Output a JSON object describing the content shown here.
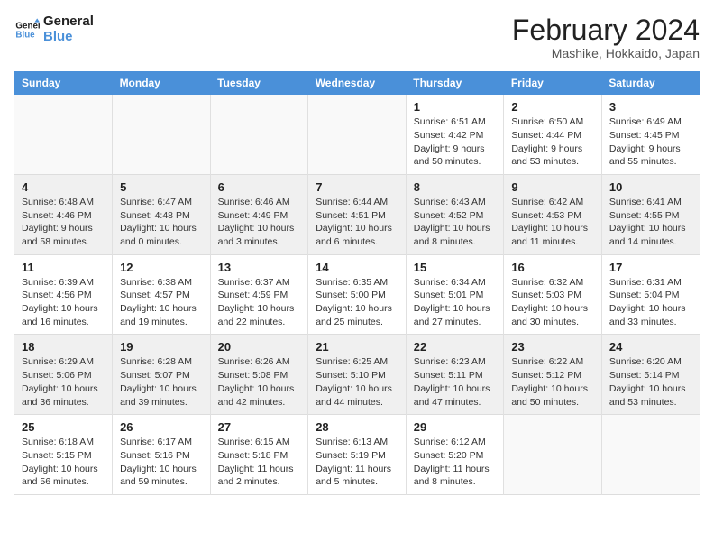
{
  "header": {
    "logo_general": "General",
    "logo_blue": "Blue",
    "title": "February 2024",
    "subtitle": "Mashike, Hokkaido, Japan"
  },
  "columns": [
    "Sunday",
    "Monday",
    "Tuesday",
    "Wednesday",
    "Thursday",
    "Friday",
    "Saturday"
  ],
  "weeks": [
    {
      "days": [
        {
          "number": "",
          "detail": ""
        },
        {
          "number": "",
          "detail": ""
        },
        {
          "number": "",
          "detail": ""
        },
        {
          "number": "",
          "detail": ""
        },
        {
          "number": "1",
          "detail": "Sunrise: 6:51 AM\nSunset: 4:42 PM\nDaylight: 9 hours\nand 50 minutes."
        },
        {
          "number": "2",
          "detail": "Sunrise: 6:50 AM\nSunset: 4:44 PM\nDaylight: 9 hours\nand 53 minutes."
        },
        {
          "number": "3",
          "detail": "Sunrise: 6:49 AM\nSunset: 4:45 PM\nDaylight: 9 hours\nand 55 minutes."
        }
      ]
    },
    {
      "days": [
        {
          "number": "4",
          "detail": "Sunrise: 6:48 AM\nSunset: 4:46 PM\nDaylight: 9 hours\nand 58 minutes."
        },
        {
          "number": "5",
          "detail": "Sunrise: 6:47 AM\nSunset: 4:48 PM\nDaylight: 10 hours\nand 0 minutes."
        },
        {
          "number": "6",
          "detail": "Sunrise: 6:46 AM\nSunset: 4:49 PM\nDaylight: 10 hours\nand 3 minutes."
        },
        {
          "number": "7",
          "detail": "Sunrise: 6:44 AM\nSunset: 4:51 PM\nDaylight: 10 hours\nand 6 minutes."
        },
        {
          "number": "8",
          "detail": "Sunrise: 6:43 AM\nSunset: 4:52 PM\nDaylight: 10 hours\nand 8 minutes."
        },
        {
          "number": "9",
          "detail": "Sunrise: 6:42 AM\nSunset: 4:53 PM\nDaylight: 10 hours\nand 11 minutes."
        },
        {
          "number": "10",
          "detail": "Sunrise: 6:41 AM\nSunset: 4:55 PM\nDaylight: 10 hours\nand 14 minutes."
        }
      ]
    },
    {
      "days": [
        {
          "number": "11",
          "detail": "Sunrise: 6:39 AM\nSunset: 4:56 PM\nDaylight: 10 hours\nand 16 minutes."
        },
        {
          "number": "12",
          "detail": "Sunrise: 6:38 AM\nSunset: 4:57 PM\nDaylight: 10 hours\nand 19 minutes."
        },
        {
          "number": "13",
          "detail": "Sunrise: 6:37 AM\nSunset: 4:59 PM\nDaylight: 10 hours\nand 22 minutes."
        },
        {
          "number": "14",
          "detail": "Sunrise: 6:35 AM\nSunset: 5:00 PM\nDaylight: 10 hours\nand 25 minutes."
        },
        {
          "number": "15",
          "detail": "Sunrise: 6:34 AM\nSunset: 5:01 PM\nDaylight: 10 hours\nand 27 minutes."
        },
        {
          "number": "16",
          "detail": "Sunrise: 6:32 AM\nSunset: 5:03 PM\nDaylight: 10 hours\nand 30 minutes."
        },
        {
          "number": "17",
          "detail": "Sunrise: 6:31 AM\nSunset: 5:04 PM\nDaylight: 10 hours\nand 33 minutes."
        }
      ]
    },
    {
      "days": [
        {
          "number": "18",
          "detail": "Sunrise: 6:29 AM\nSunset: 5:06 PM\nDaylight: 10 hours\nand 36 minutes."
        },
        {
          "number": "19",
          "detail": "Sunrise: 6:28 AM\nSunset: 5:07 PM\nDaylight: 10 hours\nand 39 minutes."
        },
        {
          "number": "20",
          "detail": "Sunrise: 6:26 AM\nSunset: 5:08 PM\nDaylight: 10 hours\nand 42 minutes."
        },
        {
          "number": "21",
          "detail": "Sunrise: 6:25 AM\nSunset: 5:10 PM\nDaylight: 10 hours\nand 44 minutes."
        },
        {
          "number": "22",
          "detail": "Sunrise: 6:23 AM\nSunset: 5:11 PM\nDaylight: 10 hours\nand 47 minutes."
        },
        {
          "number": "23",
          "detail": "Sunrise: 6:22 AM\nSunset: 5:12 PM\nDaylight: 10 hours\nand 50 minutes."
        },
        {
          "number": "24",
          "detail": "Sunrise: 6:20 AM\nSunset: 5:14 PM\nDaylight: 10 hours\nand 53 minutes."
        }
      ]
    },
    {
      "days": [
        {
          "number": "25",
          "detail": "Sunrise: 6:18 AM\nSunset: 5:15 PM\nDaylight: 10 hours\nand 56 minutes."
        },
        {
          "number": "26",
          "detail": "Sunrise: 6:17 AM\nSunset: 5:16 PM\nDaylight: 10 hours\nand 59 minutes."
        },
        {
          "number": "27",
          "detail": "Sunrise: 6:15 AM\nSunset: 5:18 PM\nDaylight: 11 hours\nand 2 minutes."
        },
        {
          "number": "28",
          "detail": "Sunrise: 6:13 AM\nSunset: 5:19 PM\nDaylight: 11 hours\nand 5 minutes."
        },
        {
          "number": "29",
          "detail": "Sunrise: 6:12 AM\nSunset: 5:20 PM\nDaylight: 11 hours\nand 8 minutes."
        },
        {
          "number": "",
          "detail": ""
        },
        {
          "number": "",
          "detail": ""
        }
      ]
    }
  ]
}
